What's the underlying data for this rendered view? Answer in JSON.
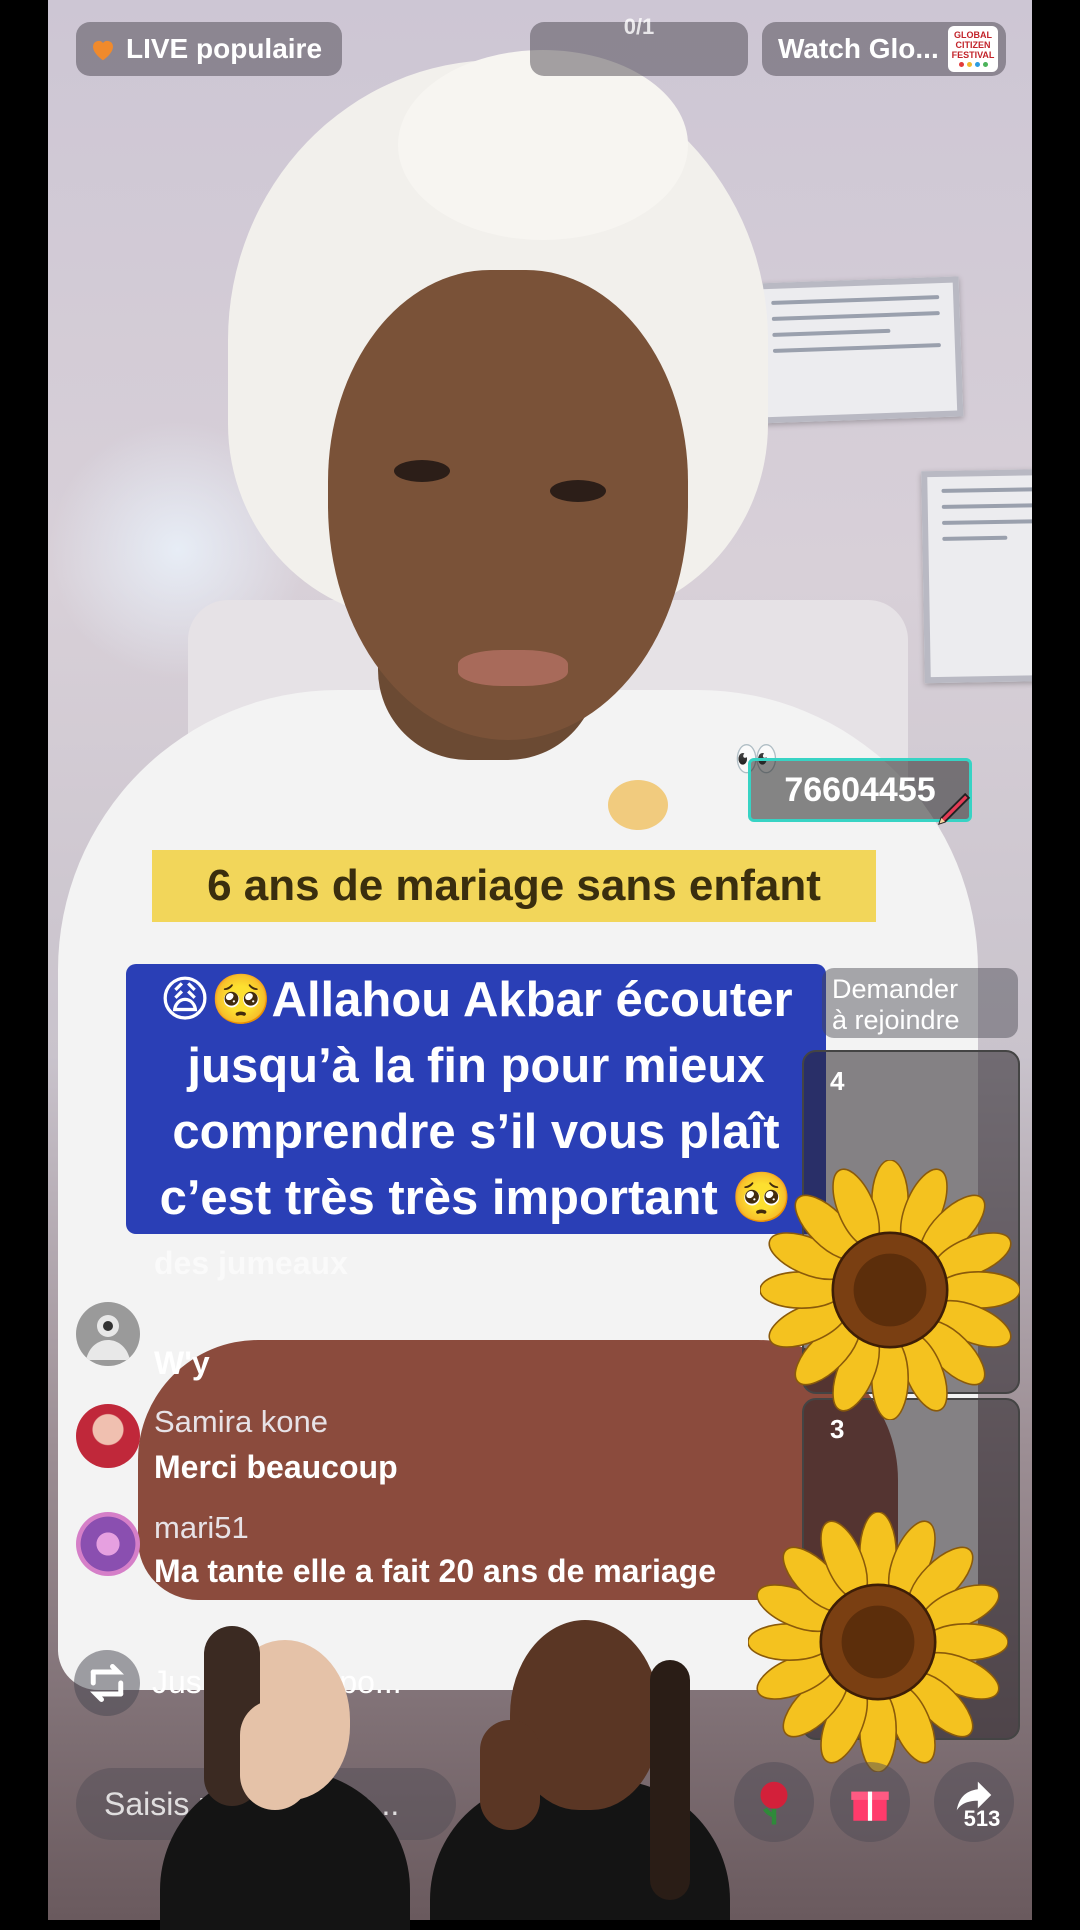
{
  "top_bar": {
    "live_label": "LIVE populaire",
    "center_text": "0/1",
    "watch_label": "Watch Glo...",
    "watch_logo_text": [
      "GLOBAL",
      "CITIZEN",
      "FESTIVAL"
    ]
  },
  "overlay": {
    "phone_number": "76604455",
    "eyes_emoji": "👀",
    "yellow_caption": "6 ans de mariage sans enfant",
    "blue_caption_lines": [
      "😩🥺Allahou Akbar écouter",
      "jusqu’à la fin pour mieux",
      "comprendre s’il vous plaît",
      "c’est très très important 🥺"
    ]
  },
  "side": {
    "join_button": [
      "Demander",
      "à rejoindre"
    ],
    "guest1_count": "4",
    "guest2_count": "3"
  },
  "chat": {
    "faded_message": "des jumeaux",
    "messages": [
      {
        "name": "",
        "text": "W'y",
        "avatar": "default-avatar-icon"
      },
      {
        "name": "Samira kone",
        "text": "Merci beaucoup",
        "avatar": "red-hair-avatar"
      },
      {
        "name": "mari51",
        "text": "Ma tante elle a fait 20 ans de mariage",
        "avatar": "purple-pattern-avatar"
      }
    ],
    "share_notice": "Jus d’ … a repo..."
  },
  "bottom": {
    "input_placeholder": "Saisis un message...",
    "share_count": "513"
  },
  "colors": {
    "yellow_caption": "#f2d65a",
    "blue_caption": "#2a3fb6",
    "sticker_border": "#37d3c4"
  }
}
